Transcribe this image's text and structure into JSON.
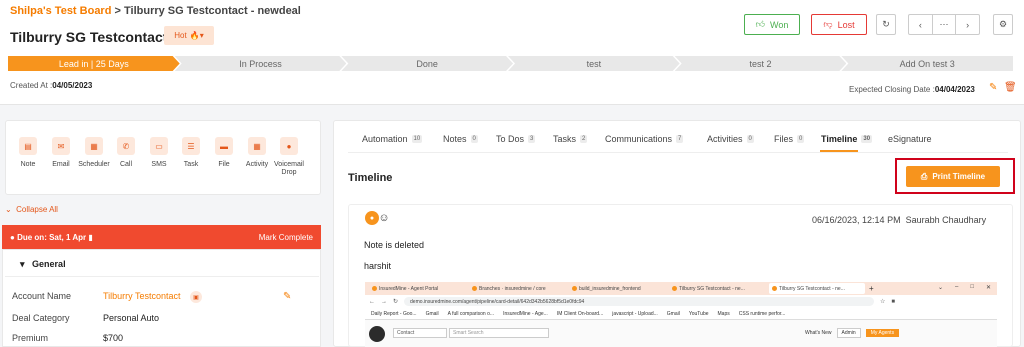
{
  "breadcrumb": {
    "board": "Shilpa's Test Board",
    "separator": ">",
    "deal": "Tilburry SG Testcontact - newdeal"
  },
  "header": {
    "title": "Tilburry SG Testcontact -",
    "hot_label": "Hot",
    "won_label": "Won",
    "lost_label": "Lost"
  },
  "pipeline": {
    "stages": [
      "Lead in | 25 Days",
      "In Process",
      "Done",
      "test",
      "test 2",
      "Add On test 3"
    ],
    "active_index": 0
  },
  "dates": {
    "created_label": "Created At :",
    "created_value": "04/05/2023",
    "closing_label": "Expected Closing Date :",
    "closing_value": "04/04/2023"
  },
  "actions": [
    {
      "label": "Note",
      "icon": "note-icon"
    },
    {
      "label": "Email",
      "icon": "email-icon"
    },
    {
      "label": "Scheduler",
      "icon": "calendar-icon"
    },
    {
      "label": "Call",
      "icon": "phone-icon"
    },
    {
      "label": "SMS",
      "icon": "sms-icon"
    },
    {
      "label": "Task",
      "icon": "task-icon"
    },
    {
      "label": "File",
      "icon": "folder-icon"
    },
    {
      "label": "Activity",
      "icon": "activity-icon"
    },
    {
      "label": "Voicemail Drop",
      "icon": "voicemail-icon"
    }
  ],
  "left": {
    "collapse_label": "Collapse All",
    "due_label": "Due on: Sat, 1 Apr",
    "mark_complete": "Mark Complete",
    "general_label": "General",
    "fields": [
      {
        "label": "Account Name",
        "value": "Tilburry Testcontact"
      },
      {
        "label": "Deal Category",
        "value": "Personal Auto"
      },
      {
        "label": "Premium",
        "value": "$700"
      }
    ]
  },
  "tabs": [
    {
      "label": "Automation",
      "count": "10"
    },
    {
      "label": "Notes",
      "count": "0"
    },
    {
      "label": "To Dos",
      "count": "3"
    },
    {
      "label": "Tasks",
      "count": "2"
    },
    {
      "label": "Communications",
      "count": "7"
    },
    {
      "label": "Activities",
      "count": "0"
    },
    {
      "label": "Files",
      "count": "0"
    },
    {
      "label": "Timeline",
      "count": "30"
    },
    {
      "label": "eSignature",
      "count": ""
    }
  ],
  "active_tab": "Timeline",
  "timeline": {
    "title": "Timeline",
    "print_label": "Print Timeline",
    "entry": {
      "timestamp": "06/16/2023, 12:14 PM",
      "author": "Saurabh Chaudhary",
      "line1": "Note is deleted",
      "line2": "harshit"
    }
  },
  "screenshot": {
    "tabs": [
      "InsuredMine - Agent Portal",
      "Branches · insuredmine / core",
      "build_insuredmine_frontend",
      "Tilburry SG Testcontact - ne...",
      "Tilburry SG Testcontact - ne..."
    ],
    "url": "demo.insuredmine.com/agent/pipeline/card-detail/642d342b5628bf5d1e0fdc94",
    "bookmarks": [
      "Daily Report - Goo...",
      "Gmail",
      "A full comparison o...",
      "InsuredMine - Age...",
      "IM Client On-board...",
      "javascript - Upload...",
      "Gmail",
      "YouTube",
      "Maps",
      "CSS runtime perfor..."
    ],
    "contact_select": "Contact",
    "search_placeholder": "Smart Search",
    "whats_new": "What's New",
    "admin": "Admin",
    "my_agents": "My Agents"
  },
  "colors": {
    "accent": "#f7941d",
    "danger": "#f04a2f",
    "won": "#4caf50",
    "lost": "#e53935",
    "highlight_box": "#d0021b"
  }
}
